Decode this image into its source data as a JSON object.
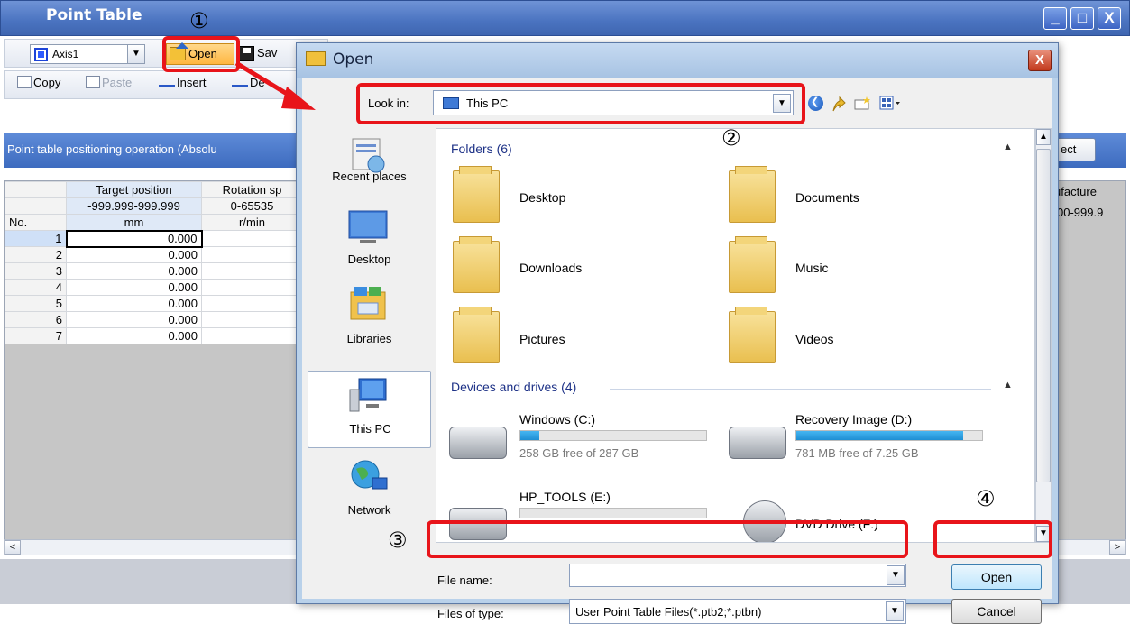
{
  "background_window": {
    "title": "Point Table",
    "min_glyph": "_",
    "max_glyph": "□",
    "close_glyph": "X",
    "axis_select": "Axis1",
    "toolbar": {
      "open": "Open",
      "save": "Sav"
    },
    "edit_toolbar": {
      "copy": "Copy",
      "paste": "Paste",
      "insert": "Insert",
      "delete_partial": "De"
    },
    "banner": "Point table positioning operation (Absolu",
    "select_button": "ect",
    "table": {
      "col_headers": [
        "Target position",
        "Rotation sp"
      ],
      "ranges": [
        "-999.999-999.999",
        "0-65535"
      ],
      "no_label": "No.",
      "units": [
        "mm",
        "r/min"
      ],
      "rows": [
        {
          "no": "1",
          "value": "0.000"
        },
        {
          "no": "2",
          "value": "0.000"
        },
        {
          "no": "3",
          "value": "0.000"
        },
        {
          "no": "4",
          "value": "0.000"
        },
        {
          "no": "5",
          "value": "0.000"
        },
        {
          "no": "6",
          "value": "0.000"
        },
        {
          "no": "7",
          "value": "0.000"
        }
      ],
      "manufacturer_partial": "ufacture",
      "manufacturer_range_partial": "00-999.9"
    },
    "scroll_left": "<",
    "scroll_right": ">"
  },
  "dialog": {
    "title": "Open",
    "close_glyph": "X",
    "look_in_label": "Look in:",
    "look_in_value": "This PC",
    "places": [
      "Recent places",
      "Desktop",
      "Libraries",
      "This PC",
      "Network"
    ],
    "folders_group": "Folders (6)",
    "folders": [
      "Desktop",
      "Documents",
      "Downloads",
      "Music",
      "Pictures",
      "Videos"
    ],
    "devices_group": "Devices and drives (4)",
    "drives": [
      {
        "name": "Windows (C:)",
        "free": "258 GB free of 287 GB",
        "used_fraction": 0.1
      },
      {
        "name": "Recovery Image (D:)",
        "free": "781 MB free of 7.25 GB",
        "used_fraction": 0.9
      },
      {
        "name": "HP_TOOLS (E:)"
      },
      {
        "name": "DVD Drive (F:)"
      }
    ],
    "file_name_label": "File name:",
    "file_name_value": "",
    "files_of_type_label": "Files of type:",
    "files_of_type_value": "User Point Table Files(*.ptb2;*.ptbn)",
    "open_button": "Open",
    "cancel_button": "Cancel"
  },
  "annotations": {
    "step1": "①",
    "step2": "②",
    "step3": "③",
    "step4": "④",
    "highlight_color": "#e8141a"
  }
}
